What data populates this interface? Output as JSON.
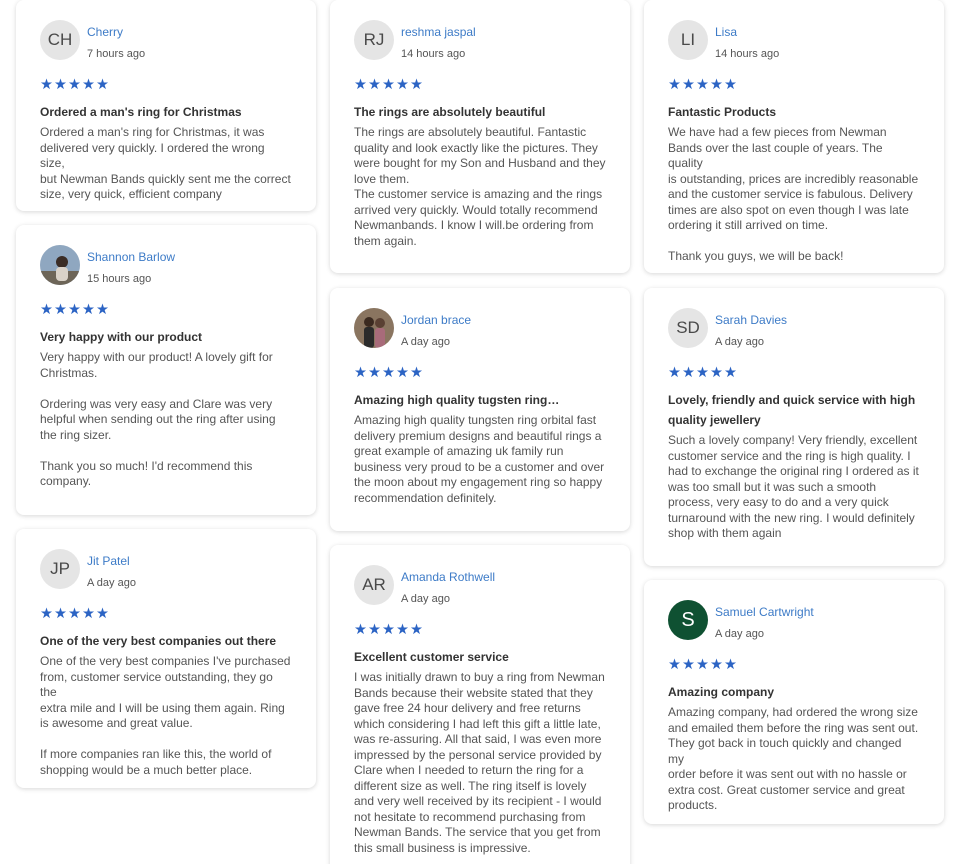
{
  "reviews": [
    {
      "initials": "CH",
      "name": "Cherry",
      "time": "7 hours ago",
      "rating": 5,
      "stars": "★★★★★",
      "title": "Ordered a man's ring for Christmas",
      "text": [
        "Ordered a man's ring for Christmas, it was",
        "delivered very quickly. I ordered the wrong size,",
        "but Newman Bands quickly sent me the correct",
        "size, very quick, efficient company"
      ]
    },
    {
      "initials": "",
      "name": "Shannon Barlow",
      "time": "15 hours ago",
      "rating": 5,
      "stars": "★★★★★",
      "title": "Very happy with our product",
      "text": [
        "Very happy with our product! A lovely gift for",
        "Christmas.",
        "",
        "Ordering was very easy and Clare was very",
        "helpful when sending out the ring after using",
        "the ring sizer.",
        "",
        "Thank you so much! I'd recommend this",
        "company."
      ]
    },
    {
      "initials": "JP",
      "name": "Jit Patel",
      "time": "A day ago",
      "rating": 5,
      "stars": "★★★★★",
      "title": "One of the very best companies out there",
      "text": [
        "One of the very best companies I've purchased",
        "from, customer service outstanding, they go the",
        "extra mile and I will be using them again. Ring",
        "is awesome and great value.",
        "",
        "If more companies ran like this, the world of",
        "shopping would be a much better place."
      ]
    },
    {
      "initials": "RJ",
      "name": "reshma jaspal",
      "time": "14 hours ago",
      "rating": 5,
      "stars": "★★★★★",
      "title": "The rings are absolutely beautiful",
      "text": [
        "The rings are absolutely beautiful. Fantastic",
        "quality and look exactly like the pictures. They",
        "were bought for my Son and Husband and they",
        "love them.",
        "The customer service is amazing and the rings",
        "arrived very quickly. Would totally recommend",
        "Newmanbands. I know I will.be ordering from",
        "them again."
      ]
    },
    {
      "initials": "",
      "name": "Jordan brace",
      "time": "A day ago",
      "rating": 5,
      "stars": "★★★★★",
      "title": "Amazing high quality tugsten ring…",
      "text": [
        "Amazing high quality tungsten ring orbital fast",
        "delivery premium designs and beautiful rings a",
        "great example of amazing uk family run",
        "business very proud to be a customer and over",
        "the moon about my engagement ring so happy",
        "recommendation definitely."
      ]
    },
    {
      "initials": "AR",
      "name": "Amanda Rothwell",
      "time": "A day ago",
      "rating": 5,
      "stars": "★★★★★",
      "title": "Excellent customer service",
      "text": [
        "I was initially drawn to buy a ring from Newman",
        "Bands because their website stated that they",
        "gave free 24 hour delivery and free returns",
        "which considering I had left this gift a little late,",
        "was re-assuring. All that said, I was even more",
        "impressed by the personal service provided by",
        "Clare when I needed to return the ring for a",
        "different size as well. The ring itself is lovely",
        "and very well received by its recipient - I would",
        "not hesitate to recommend purchasing from",
        "Newman Bands. The service that you get from",
        "this small business is impressive."
      ]
    },
    {
      "initials": "LI",
      "name": "Lisa",
      "time": "14 hours ago",
      "rating": 5,
      "stars": "★★★★★",
      "title": "Fantastic Products",
      "text": [
        "We have had a few pieces from Newman",
        "Bands over the last couple of years. The quality",
        "is outstanding, prices are incredibly reasonable",
        "and the customer service is fabulous. Delivery",
        "times are also spot on even though I was late",
        "ordering it still arrived on time.",
        "",
        "Thank you guys, we will be back!"
      ]
    },
    {
      "initials": "SD",
      "name": "Sarah Davies",
      "time": "A day ago",
      "rating": 5,
      "stars": "★★★★★",
      "title": "Lovely, friendly and quick service with high quality jewellery",
      "text": [
        "Such a lovely company! Very friendly, excellent",
        "customer service and the ring is high quality. I",
        "had to exchange the original ring I ordered as it",
        "was too small but it was such a smooth",
        "process, very easy to do and a very quick",
        "turnaround with the new ring. I would definitely",
        "shop with them again"
      ]
    },
    {
      "initials": "S",
      "name": "Samuel Cartwright",
      "time": "A day ago",
      "rating": 5,
      "stars": "★★★★★",
      "title": "Amazing company",
      "text": [
        "Amazing company, had ordered the wrong size",
        "and emailed them before the ring was sent out.",
        "They got back in touch quickly and changed my",
        "order before it was sent out with no hassle or",
        "extra cost. Great customer service and great",
        "products."
      ]
    }
  ],
  "colors": {
    "star": "#2c64c4",
    "name_link": "#3d7bc7",
    "avatar_green": "#0f5132"
  }
}
